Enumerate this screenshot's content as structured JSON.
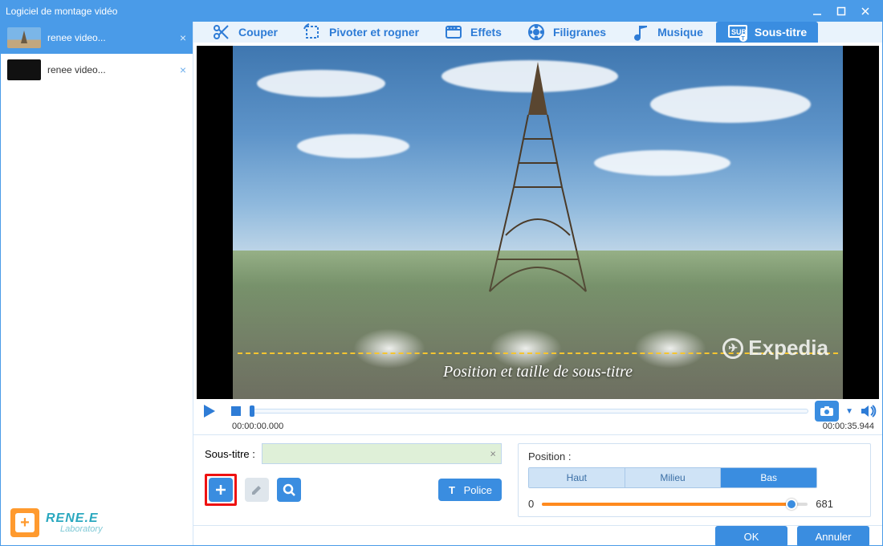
{
  "window": {
    "title": "Logiciel de montage vidéo"
  },
  "sidebar": {
    "clips": [
      {
        "label": "renee video...",
        "active": true
      },
      {
        "label": "renee video...",
        "active": false
      }
    ],
    "logo": {
      "line1": "RENE.E",
      "line2": "Laboratory"
    }
  },
  "tabs": [
    {
      "id": "couper",
      "label": "Couper"
    },
    {
      "id": "pivoter",
      "label": "Pivoter et rogner"
    },
    {
      "id": "effets",
      "label": "Effets"
    },
    {
      "id": "filigranes",
      "label": "Filigranes"
    },
    {
      "id": "musique",
      "label": "Musique"
    },
    {
      "id": "soustitre",
      "label": "Sous-titre"
    }
  ],
  "active_tab": "soustitre",
  "preview": {
    "subtitle_overlay": "Position et taille de sous-titre",
    "watermark_text": "Expedia"
  },
  "playback": {
    "current_time": "00:00:00.000",
    "total_time": "00:00:35.944"
  },
  "subtitle_panel": {
    "label": "Sous-titre :",
    "input_value": "",
    "font_button": "Police"
  },
  "position_panel": {
    "label": "Position :",
    "options": [
      "Haut",
      "Milieu",
      "Bas"
    ],
    "selected": 2,
    "slider_min": "0",
    "slider_max": "681",
    "slider_value": 640
  },
  "footer": {
    "ok": "OK",
    "cancel": "Annuler"
  }
}
